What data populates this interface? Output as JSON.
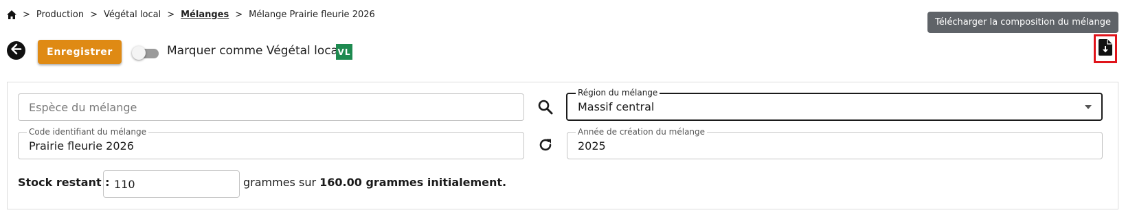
{
  "breadcrumb": {
    "home_icon": "home-icon",
    "items": [
      "Production",
      "Végétal local",
      "Mélanges",
      "Mélange Prairie fleurie 2026"
    ],
    "current_index": 2
  },
  "toolbar": {
    "back_icon": "arrow-back-icon",
    "save_label": "Enregistrer",
    "toggle_label": "Marquer comme Végétal local",
    "toggle_on": false,
    "badge": "VL",
    "download_icon": "file-download-icon",
    "download_tooltip": "Télécharger la composition du mélange"
  },
  "form": {
    "species": {
      "placeholder": "Espèce du mélange",
      "value": ""
    },
    "region": {
      "label": "Région du mélange",
      "value": "Massif central"
    },
    "code": {
      "label": "Code identifiant du mélange",
      "value": "Prairie fleurie 2026"
    },
    "year": {
      "label": "Année de création du mélange",
      "value": "2025"
    },
    "search_icon": "search-icon",
    "refresh_icon": "refresh-icon"
  },
  "stock": {
    "label": "Stock restant :",
    "value": "110",
    "text_before": "grammes sur ",
    "text_bold": "160.00 grammes initialement."
  },
  "colors": {
    "accent": "#df8a14",
    "badge": "#1e8a50",
    "highlight": "#e0141b",
    "tooltip": "#5f6368"
  }
}
